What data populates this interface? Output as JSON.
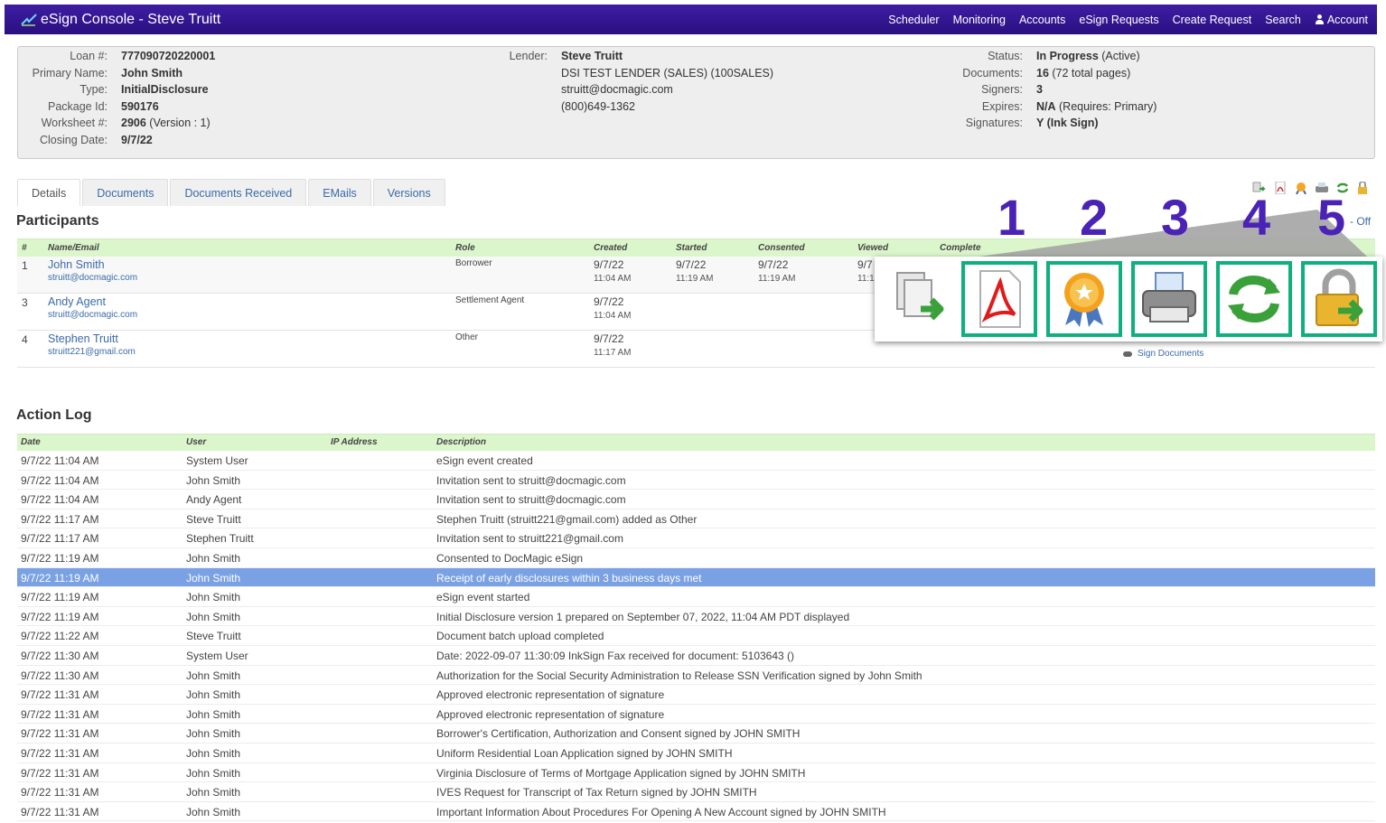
{
  "header": {
    "title": "eSign Console - Steve Truitt",
    "nav": [
      "Scheduler",
      "Monitoring",
      "Accounts",
      "eSign Requests",
      "Create Request",
      "Search",
      "Account"
    ]
  },
  "summary": {
    "left": [
      {
        "k": "Loan #:",
        "v": "777090720220001",
        "extra": ""
      },
      {
        "k": "Primary Name:",
        "v": "John Smith",
        "extra": ""
      },
      {
        "k": "Type:",
        "v": "InitialDisclosure",
        "extra": ""
      },
      {
        "k": "Package Id:",
        "v": "590176",
        "extra": ""
      },
      {
        "k": "Worksheet #:",
        "v": "2906",
        "extra": " (Version : 1)"
      },
      {
        "k": "Closing Date:",
        "v": "9/7/22",
        "extra": ""
      }
    ],
    "lender": {
      "label": "Lender:",
      "name": "Steve Truitt",
      "lines": [
        "DSI TEST LENDER (SALES) (100SALES)",
        "struitt@docmagic.com",
        "(800)649-1362"
      ]
    },
    "right": [
      {
        "k": "Status:",
        "v": "In Progress",
        "extra": " (Active)"
      },
      {
        "k": "Documents:",
        "v": "16",
        "extra": " (72 total pages)"
      },
      {
        "k": "Signers:",
        "v": "3",
        "extra": ""
      },
      {
        "k": "Expires:",
        "v": "N/A",
        "extra": " (Requires: Primary)"
      },
      {
        "k": "Signatures:",
        "v": "Y (Ink Sign)",
        "extra": ""
      }
    ]
  },
  "tabs": [
    "Details",
    "Documents",
    "Documents Received",
    "EMails",
    "Versions"
  ],
  "participants": {
    "title": "Participants",
    "off_link": "- Off",
    "columns": [
      "#",
      "Name/Email",
      "Role",
      "Created",
      "Started",
      "Consented",
      "Viewed",
      "Complete"
    ],
    "rows": [
      {
        "num": "1",
        "name": "John Smith",
        "email": "struitt@docmagic.com",
        "role": "Borrower",
        "created_d": "9/7/22",
        "created_t": "11:04 AM",
        "started_d": "9/7/22",
        "started_t": "11:19 AM",
        "consented_d": "9/7/22",
        "consented_t": "11:19 AM",
        "viewed_d": "9/7",
        "viewed_t": "11:1"
      },
      {
        "num": "3",
        "name": "Andy Agent",
        "email": "struitt@docmagic.com",
        "role": "Settlement Agent",
        "created_d": "9/7/22",
        "created_t": "11:04 AM",
        "started_d": "",
        "started_t": "",
        "consented_d": "",
        "consented_t": "",
        "viewed_d": "",
        "viewed_t": ""
      },
      {
        "num": "4",
        "name": "Stephen Truitt",
        "email": "struitt221@gmail.com",
        "role": "Other",
        "created_d": "9/7/22",
        "created_t": "11:17 AM",
        "started_d": "",
        "started_t": "",
        "consented_d": "",
        "consented_t": "",
        "viewed_d": "",
        "viewed_t": ""
      }
    ],
    "sign_documents": "Sign Documents"
  },
  "action_log": {
    "title": "Action Log",
    "columns": [
      "Date",
      "User",
      "IP Address",
      "Description"
    ],
    "rows": [
      {
        "date": "9/7/22 11:04 AM",
        "user": "System User",
        "desc": "eSign event created"
      },
      {
        "date": "9/7/22 11:04 AM",
        "user": "John Smith",
        "desc": "Invitation sent to struitt@docmagic.com"
      },
      {
        "date": "9/7/22 11:04 AM",
        "user": "Andy Agent",
        "desc": "Invitation sent to struitt@docmagic.com"
      },
      {
        "date": "9/7/22 11:17 AM",
        "user": "Steve Truitt",
        "desc": "Stephen Truitt (struitt221@gmail.com) added as Other"
      },
      {
        "date": "9/7/22 11:17 AM",
        "user": "Stephen Truitt",
        "desc": "Invitation sent to struitt221@gmail.com"
      },
      {
        "date": "9/7/22 11:19 AM",
        "user": "John Smith",
        "desc": "Consented to DocMagic eSign"
      },
      {
        "date": "9/7/22 11:19 AM",
        "user": "John Smith",
        "desc": "Receipt of early disclosures within 3 business days met",
        "selected": true
      },
      {
        "date": "9/7/22 11:19 AM",
        "user": "John Smith",
        "desc": "eSign event started"
      },
      {
        "date": "9/7/22 11:19 AM",
        "user": "John Smith",
        "desc": "Initial Disclosure version 1 prepared on September 07, 2022, 11:04 AM PDT displayed"
      },
      {
        "date": "9/7/22 11:22 AM",
        "user": "Steve Truitt",
        "desc": "Document batch upload completed"
      },
      {
        "date": "9/7/22 11:30 AM",
        "user": "System User",
        "desc": "Date: 2022-09-07 11:30:09 InkSign Fax received for document: 5103643 ()"
      },
      {
        "date": "9/7/22 11:30 AM",
        "user": "John Smith",
        "desc": "Authorization for the Social Security Administration to Release SSN Verification signed by John Smith"
      },
      {
        "date": "9/7/22 11:31 AM",
        "user": "John Smith",
        "desc": "Approved electronic representation of signature"
      },
      {
        "date": "9/7/22 11:31 AM",
        "user": "John Smith",
        "desc": "Approved electronic representation of signature"
      },
      {
        "date": "9/7/22 11:31 AM",
        "user": "John Smith",
        "desc": "Borrower's Certification, Authorization and Consent signed by JOHN SMITH"
      },
      {
        "date": "9/7/22 11:31 AM",
        "user": "John Smith",
        "desc": "Uniform Residential Loan Application signed by JOHN SMITH"
      },
      {
        "date": "9/7/22 11:31 AM",
        "user": "John Smith",
        "desc": "Virginia Disclosure of Terms of Mortgage Application signed by JOHN SMITH"
      },
      {
        "date": "9/7/22 11:31 AM",
        "user": "John Smith",
        "desc": "IVES Request for Transcript of Tax Return signed by JOHN SMITH"
      },
      {
        "date": "9/7/22 11:31 AM",
        "user": "John Smith",
        "desc": "Important Information About Procedures For Opening A New Account signed by JOHN SMITH"
      }
    ]
  },
  "callout": {
    "numbers": [
      "1",
      "2",
      "3",
      "4",
      "5"
    ],
    "icons": [
      "copy-export-icon",
      "pdf-icon",
      "certificate-icon",
      "print-icon",
      "refresh-icon",
      "lock-export-icon"
    ],
    "highlight_color": "#0eb07e",
    "number_color": "#4a23b6"
  },
  "colors": {
    "header_bg": "#2a0f80",
    "table_header_bg": "#dcf6cc",
    "selected_row_bg": "#7aa1e3",
    "link": "#3b6aa8"
  }
}
